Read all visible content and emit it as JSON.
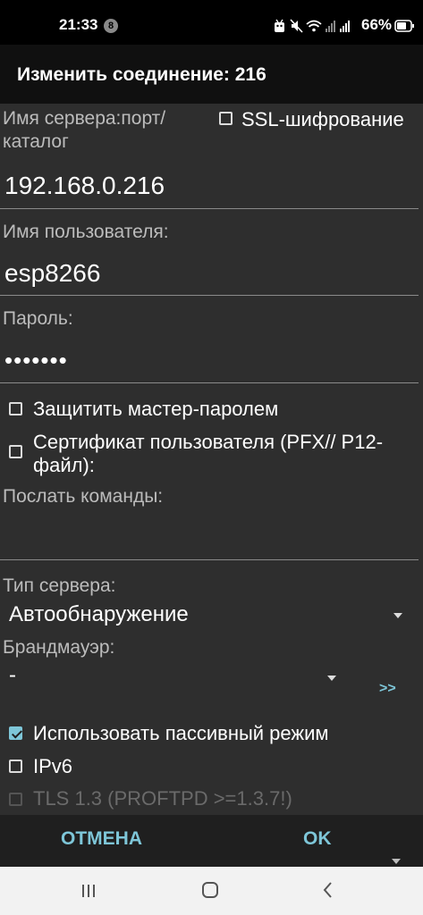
{
  "status_bar": {
    "time": "21:33",
    "notification_count": "8",
    "icons": [
      "android-icon",
      "mute-icon",
      "wifi-icon",
      "signal-icon",
      "signal-icon"
    ],
    "battery": "66%"
  },
  "dialog": {
    "title": "Изменить соединение: 216"
  },
  "form": {
    "server_label": "Имя сервера:порт/каталог",
    "ssl_label": "SSL-шифрование",
    "ssl_checked": false,
    "server_value": "192.168.0.216",
    "user_label": "Имя пользователя:",
    "user_value": "esp8266",
    "password_label": "Пароль:",
    "password_value": "•••••••",
    "master_password_label": "Защитить мастер-паролем",
    "master_password_checked": false,
    "certificate_label": "Сертификат пользователя (PFX// P12-файл):",
    "certificate_checked": false,
    "commands_label": "Послать команды:",
    "commands_value": "",
    "server_type_label": "Тип сервера:",
    "server_type_value": "Автообнаружение",
    "firewall_label": "Брандмауэр:",
    "firewall_value": "-",
    "more_label": ">>",
    "passive_label": "Использовать пассивный режим",
    "passive_checked": true,
    "ipv6_label": "IPv6",
    "ipv6_checked": false,
    "tls_label": "TLS 1.3 (PROFTPD >=1.3.7!)",
    "tls_enabled": false
  },
  "buttons": {
    "cancel": "ОТМЕНА",
    "ok": "OK"
  },
  "nav_bar": {
    "icons": [
      "recent-apps-icon",
      "home-icon",
      "back-icon"
    ]
  },
  "colors": {
    "accent": "#7ec6d8",
    "background": "#2e2e2e",
    "title_bar": "#101010"
  }
}
